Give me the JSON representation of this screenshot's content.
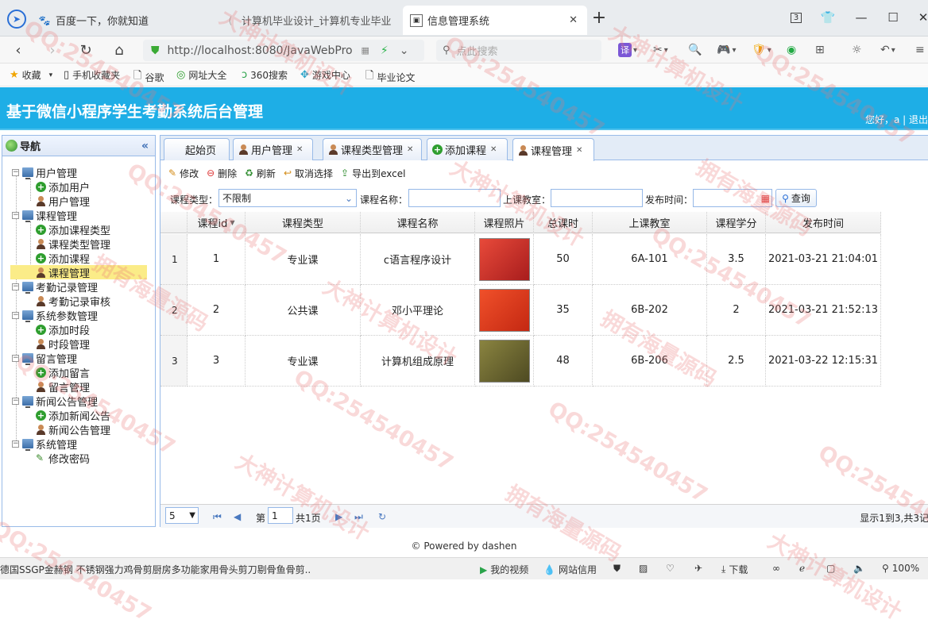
{
  "browser": {
    "tabs": [
      {
        "label": "百度一下，你就知道"
      },
      {
        "label": "计算机毕业设计_计算机专业毕业"
      },
      {
        "label": "信息管理系统"
      }
    ],
    "new_tab": "+",
    "win_ctrl": {
      "count": "3"
    },
    "url": "http://localhost:8080/JavaWebPro",
    "search_placeholder": "点此搜索",
    "toolbar": {
      "translate": "译"
    },
    "bookmarks": [
      "收藏",
      "手机收藏夹",
      "谷歌",
      "网址大全",
      "360搜索",
      "游戏中心",
      "毕业论文"
    ]
  },
  "app": {
    "title": "基于微信小程序学生考勤系统后台管理",
    "greeting": "您好，a | 退出"
  },
  "sidebar": {
    "title": "导航",
    "groups": [
      {
        "label": "用户管理",
        "items": [
          "添加用户",
          "用户管理"
        ]
      },
      {
        "label": "课程管理",
        "items": [
          "添加课程类型",
          "课程类型管理",
          "添加课程",
          "课程管理"
        ]
      },
      {
        "label": "考勤记录管理",
        "items": [
          "考勤记录审核"
        ]
      },
      {
        "label": "系统参数管理",
        "items": [
          "添加时段",
          "时段管理"
        ]
      },
      {
        "label": "留言管理",
        "items": [
          "添加留言",
          "留言管理"
        ]
      },
      {
        "label": "新闻公告管理",
        "items": [
          "添加新闻公告",
          "新闻公告管理"
        ]
      },
      {
        "label": "系统管理",
        "items": [
          "修改密码"
        ]
      }
    ]
  },
  "tabs": [
    "起始页",
    "用户管理",
    "课程类型管理",
    "添加课程",
    "课程管理"
  ],
  "toolbar": {
    "edit": "修改",
    "delete": "删除",
    "refresh": "刷新",
    "cancel_select": "取消选择",
    "export": "导出到excel"
  },
  "filter": {
    "type_label": "课程类型：",
    "type_value": "不限制",
    "name_label": "课程名称：",
    "room_label": "上课教室：",
    "time_label": "发布时间：",
    "query": "查询"
  },
  "grid": {
    "columns": [
      "课程id",
      "课程类型",
      "课程名称",
      "课程照片",
      "总课时",
      "上课教室",
      "课程学分",
      "发布时间"
    ],
    "rows": [
      {
        "n": "1",
        "id": "1",
        "type": "专业课",
        "name": "c语言程序设计",
        "hours": "50",
        "room": "6A-101",
        "credit": "3.5",
        "time": "2021-03-21 21:04:01",
        "photo_color": "#c8262a"
      },
      {
        "n": "2",
        "id": "2",
        "type": "公共课",
        "name": "邓小平理论",
        "hours": "35",
        "room": "6B-202",
        "credit": "2",
        "time": "2021-03-21 21:52:13",
        "photo_color": "#d93a1e"
      },
      {
        "n": "3",
        "id": "3",
        "type": "专业课",
        "name": "计算机组成原理",
        "hours": "48",
        "room": "6B-206",
        "credit": "2.5",
        "time": "2021-03-22 12:15:31",
        "photo_color": "#6f6a2e"
      }
    ]
  },
  "pager": {
    "page_size": "5",
    "page_prefix": "第",
    "page_value": "1",
    "page_suffix": "共1页",
    "summary": "显示1到3,共3记"
  },
  "footer": "© Powered by dashen",
  "statusbar": {
    "news": "德国SSGP金赫钢 不锈钢强力鸡骨剪厨房多功能家用骨头剪刀剔骨鱼骨剪...",
    "video": "我的视频",
    "trust": "网站信用",
    "download": "下载",
    "zoom": "100%"
  },
  "watermarks": [
    "QQ:254540457",
    "大神计算机设计",
    "拥有海量源码"
  ]
}
